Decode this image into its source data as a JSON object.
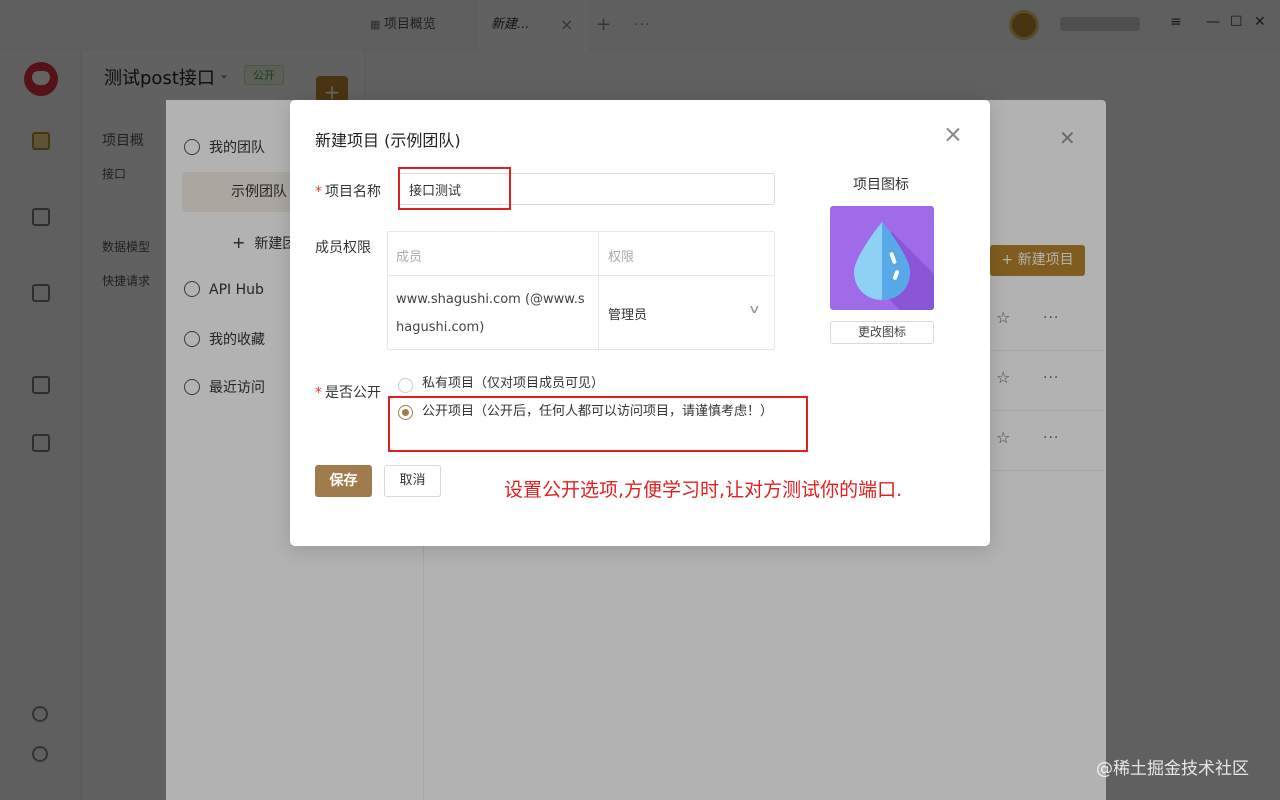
{
  "tabs": [
    {
      "label": "项目概览",
      "icon": "grid-icon"
    },
    {
      "label": "新建...",
      "active": true
    }
  ],
  "tab_add": "+",
  "tab_more": "···",
  "window_controls": {
    "menu": "≡",
    "minimize": "—",
    "maximize": "☐",
    "close": "✕"
  },
  "project": {
    "title": "测试post接口",
    "chevron": "⌄",
    "visibility_badge": "公开",
    "plus": "+",
    "items": [
      "项目概",
      "接口",
      "数据模型",
      "快捷请求"
    ]
  },
  "sidebar": {
    "items": [
      {
        "icon": "team-icon"
      },
      {
        "icon": "api-hub-icon"
      },
      {
        "icon": "collection-icon"
      },
      {
        "icon": "doc-icon"
      },
      {
        "icon": "cookie-icon"
      }
    ]
  },
  "team_modal": {
    "nav": [
      {
        "label": "我的团队",
        "icon": "users-icon"
      },
      {
        "label": "示例团队",
        "selected": true
      },
      {
        "label": "新建团",
        "icon": "plus-icon",
        "prefix": "+"
      },
      {
        "label": "API Hub",
        "icon": "hub-icon"
      },
      {
        "label": "我的收藏",
        "icon": "star-icon"
      },
      {
        "label": "最近访问",
        "icon": "clock-icon"
      }
    ],
    "new_project_button": "+ 新建项目",
    "close": "✕",
    "row_star": "☆",
    "row_more": "···"
  },
  "dialog": {
    "title": "新建项目 (示例团队)",
    "name_label": "项目名称",
    "name_value": "接口测试",
    "required_mark": "*",
    "members_label": "成员权限",
    "member_table": {
      "headers": [
        "成员",
        "权限"
      ],
      "rows": [
        {
          "member": "www.shagushi.com (@www.shagushi.com)",
          "role": "管理员"
        }
      ],
      "role_chevron": "∨"
    },
    "icon_label": "项目图标",
    "change_icon_button": "更改图标",
    "public_label": "是否公开",
    "options": [
      {
        "label": "私有项目（仅对项目成员可见）",
        "checked": false
      },
      {
        "label": "公开项目（公开后，任何人都可以访问项目，请谨慎考虑！）",
        "checked": true
      }
    ],
    "save_button": "保存",
    "cancel_button": "取消",
    "accent_color": "#a07c4c",
    "icon_bg_color": "#9f6be8"
  },
  "annotation": {
    "text": "设置公开选项,方便学习时,让对方测试你的端口.",
    "color": "#e02020"
  },
  "watermark": "@稀土掘金技术社区"
}
